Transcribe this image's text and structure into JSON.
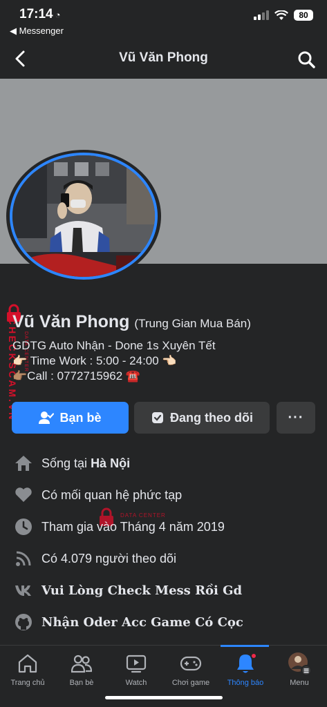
{
  "status_bar": {
    "time": "17:14",
    "back_app": "◀ Messenger",
    "battery": "80"
  },
  "nav": {
    "title": "Vũ Văn Phong"
  },
  "profile": {
    "name": "Vũ Văn Phong",
    "alternate_name": "(Trung Gian Mua Bán)",
    "bio_lines": [
      "GDTG Auto Nhận - Done 1s Xuyên Tết",
      "👉🏻 Time Work : 5:00 - 24:00 👈🏻",
      "👉🏽Call : 0772715962 ☎️"
    ]
  },
  "actions": {
    "friends_label": "Bạn bè",
    "following_label": "Đang theo dõi",
    "more_label": "···"
  },
  "details": {
    "lives_prefix": "Sống tại ",
    "lives_city": "Hà Nội",
    "relationship": "Có mối quan hệ phức tạp",
    "joined": "Tham gia vào Tháng 4 năm 2019",
    "followers": "Có 4.079 người theo dõi",
    "vk_text": "Vui Lòng Check Mess Rồi Gd",
    "github_text": "Nhận Oder Acc Game Có Cọc"
  },
  "watermark": {
    "side_text": "CHECKSCAM.VN",
    "side_sub": "DATA CENTER",
    "mid_text": "DATA CENTER"
  },
  "tabs": [
    {
      "label": "Trang chủ",
      "icon": "home-icon"
    },
    {
      "label": "Bạn bè",
      "icon": "friends-icon"
    },
    {
      "label": "Watch",
      "icon": "watch-icon"
    },
    {
      "label": "Chơi game",
      "icon": "gaming-icon"
    },
    {
      "label": "Thông báo",
      "icon": "bell-icon",
      "active": true
    },
    {
      "label": "Menu",
      "icon": "menu-avatar-icon"
    }
  ],
  "colors": {
    "accent": "#2d86ff",
    "background": "#242526",
    "cover": "#979a9c",
    "watermark": "#d4102a"
  }
}
